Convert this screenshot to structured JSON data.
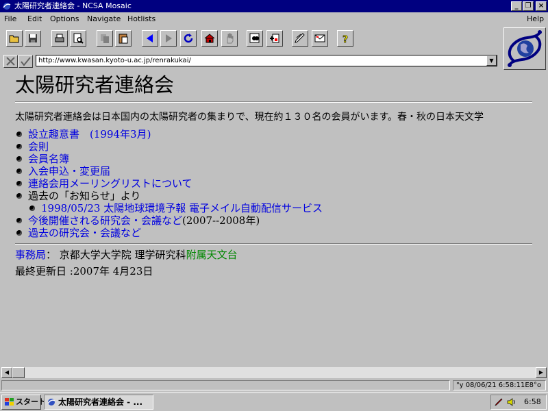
{
  "window": {
    "title": "太陽研究者連絡会 - NCSA Mosaic"
  },
  "menu": [
    {
      "label": "File"
    },
    {
      "label": "Edit"
    },
    {
      "label": "Options"
    },
    {
      "label": "Navigate"
    },
    {
      "label": "Hotlists"
    },
    {
      "label": "Help"
    }
  ],
  "toolbar": {
    "icons": [
      "open-icon",
      "save-icon",
      "print-icon",
      "print-preview-icon",
      "copy-icon",
      "paste-icon",
      "back-icon",
      "forward-icon",
      "reload-icon",
      "home-icon",
      "stop-icon",
      "find-icon",
      "add-hotlist-icon",
      "annotate-icon",
      "mail-icon",
      "help-icon"
    ]
  },
  "address": {
    "url": "http://www.kwasan.kyoto-u.ac.jp/renrakukai/"
  },
  "page": {
    "heading": "太陽研究者連絡会",
    "intro": "太陽研究者連絡会は日本国内の太陽研究者の集まりで、現在約１３０名の会員がいます。春・秋の日本天文学",
    "links": [
      {
        "text": "設立趣意書　(1994年3月)"
      },
      {
        "text": "会則"
      },
      {
        "text": "会員名簿"
      },
      {
        "text": "入会申込・変更届"
      },
      {
        "text": "連絡会用メーリングリストについて"
      }
    ],
    "past_notices": "過去の「お知らせ」より",
    "sub_link": "1998/05/23 太陽地球環境予報 電子メイル自動配信サービス",
    "upcoming_link": "今後開催される研究会・会議など",
    "upcoming_suffix": "(2007--2008年)",
    "past_link": "過去の研究会・会議など",
    "office_label": "事務局",
    "office_sep": "： 京都大学大学院 理学研究科",
    "office_link": "附属天文台",
    "updated": "最終更新日 :2007年 4月23日"
  },
  "status": {
    "text": "\"y 08/06/21 6:58:11E8°o"
  },
  "taskbar": {
    "start": "スタート",
    "task": "太陽研究者連絡会 - ...",
    "clock": "6:58"
  },
  "colors": {
    "titlebar": "#000080",
    "link": "#0000e0",
    "visited_green": "#008800",
    "chrome": "#c0c0c0"
  }
}
